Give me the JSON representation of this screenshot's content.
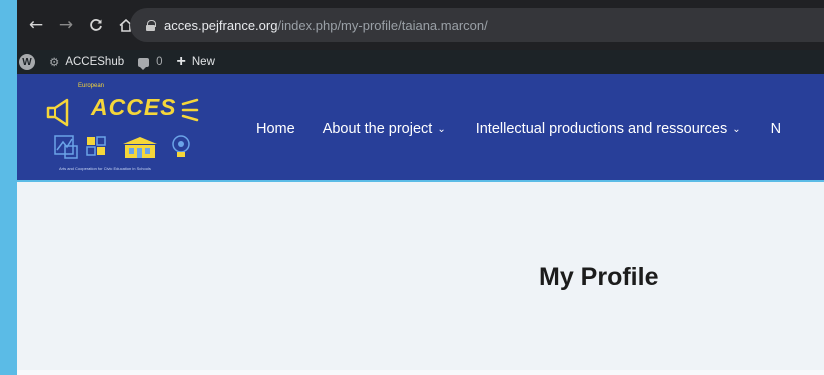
{
  "browser": {
    "back_icon": "←",
    "forward_icon": "→",
    "reload_icon": "C",
    "home_icon": "⌂",
    "url_host": "acces.pejfrance.org",
    "url_path": "/index.php/my-profile/taiana.marcon/"
  },
  "wp_admin_bar": {
    "site_name": "ACCEShub",
    "comment_count": "0",
    "new_label": "New"
  },
  "logo": {
    "european": "European",
    "acces": "ACCES",
    "tagline": "Arts and Cooperation for Civic Education in Schools"
  },
  "nav": {
    "items": [
      {
        "label": "Home",
        "has_dropdown": false
      },
      {
        "label": "About the project",
        "has_dropdown": true
      },
      {
        "label": "Intellectual productions and ressources",
        "has_dropdown": true
      },
      {
        "label": "N",
        "has_dropdown": false
      }
    ]
  },
  "page": {
    "title": "My Profile"
  },
  "colors": {
    "header_blue": "#283f99",
    "logo_yellow": "#f5d63a",
    "frame_blue": "#5bbbe6",
    "content_bg": "#eff3f7"
  }
}
